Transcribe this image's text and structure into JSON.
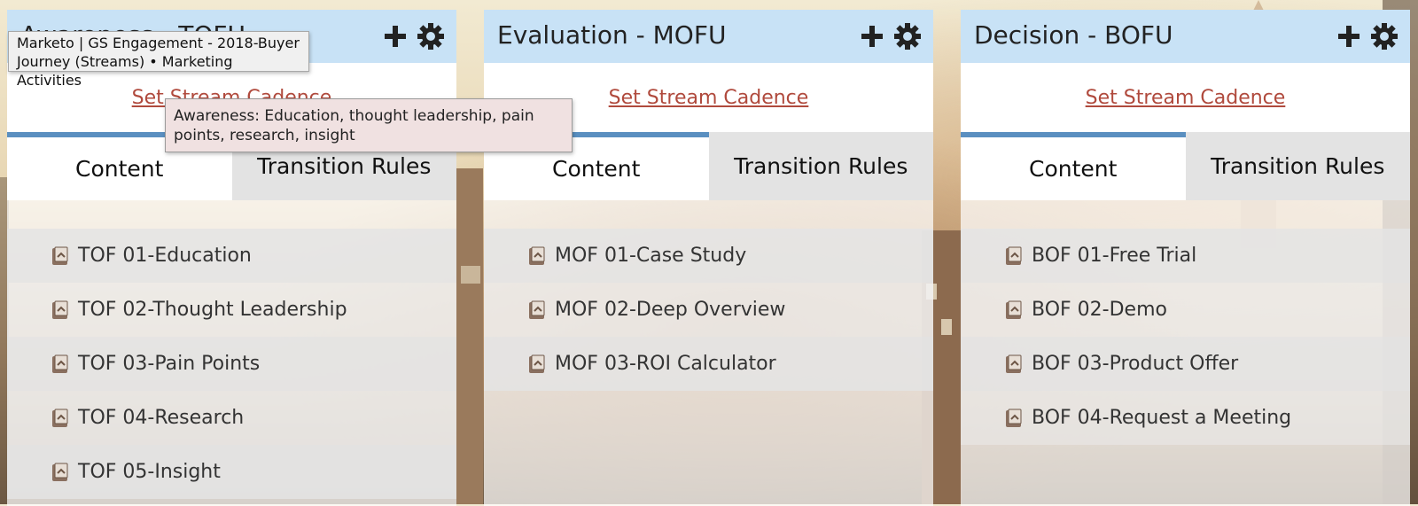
{
  "streams": [
    {
      "title": "Awareness - TOFU",
      "cadence_link": "Set Stream Cadence",
      "tabs": [
        "Content",
        "Transition Rules"
      ],
      "items": [
        "TOF 01-Education",
        "TOF 02-Thought Leadership",
        "TOF 03-Pain Points",
        "TOF 04-Research",
        "TOF 05-Insight"
      ]
    },
    {
      "title": "Evaluation - MOFU",
      "cadence_link": "Set Stream Cadence",
      "tabs": [
        "Content",
        "Transition Rules"
      ],
      "items": [
        "MOF 01-Case Study",
        "MOF 02-Deep Overview",
        "MOF 03-ROI Calculator"
      ]
    },
    {
      "title": "Decision - BOFU",
      "cadence_link": "Set Stream Cadence",
      "tabs": [
        "Content",
        "Transition Rules"
      ],
      "items": [
        "BOF 01-Free Trial",
        "BOF 02-Demo",
        "BOF 03-Product Offer",
        "BOF 04-Request a Meeting"
      ]
    }
  ],
  "tooltips": {
    "window_title": "Marketo | GS Engagement - 2018-Buyer Journey (Streams) • Marketing Activities",
    "stream_description": "Awareness: Education, thought leadership, pain points, research, insight"
  },
  "icons": {
    "add": "plus-icon",
    "settings": "gear-icon",
    "content": "email-icon"
  },
  "colors": {
    "header": "#c8e2f6",
    "link": "#b04a3d",
    "active_tab_border": "#5a8fc0"
  }
}
